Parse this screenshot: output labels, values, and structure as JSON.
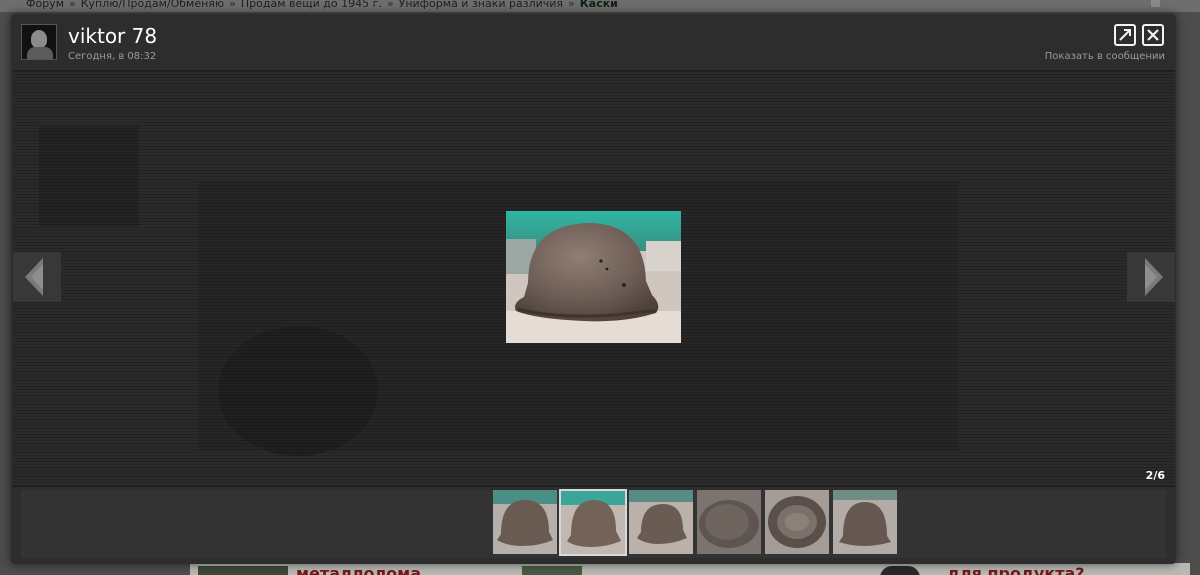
{
  "breadcrumb": {
    "items": [
      "Форум",
      "Куплю/Продам/Обменяю",
      "Продам вещи до 1945 г.",
      "Униформа и знаки различия",
      "Каски"
    ],
    "separator": "»"
  },
  "background": {
    "red_left": "металлолома",
    "red_right": "для продукта?"
  },
  "lightbox": {
    "user_name": "viktor 78",
    "post_time": "Сегодня, в 08:32",
    "show_in_post": "Показать в сообщении",
    "counter": "2/6",
    "thumbnails": [
      {
        "id": 1,
        "icon": "helmet-photo-side"
      },
      {
        "id": 2,
        "icon": "helmet-photo-side",
        "active": true
      },
      {
        "id": 3,
        "icon": "helmet-photo-side"
      },
      {
        "id": 4,
        "icon": "helmet-photo-top"
      },
      {
        "id": 5,
        "icon": "helmet-photo-inside"
      },
      {
        "id": 6,
        "icon": "helmet-photo-front"
      }
    ]
  },
  "icons": {
    "open": "external-link-icon",
    "close": "close-icon",
    "prev": "arrow-left-icon",
    "next": "arrow-right-icon"
  },
  "colors": {
    "overlay_bg": "#2d2d2d",
    "text_primary": "#ffffff",
    "text_muted": "#9a9a9a",
    "active_border": "#d8d8d8"
  }
}
